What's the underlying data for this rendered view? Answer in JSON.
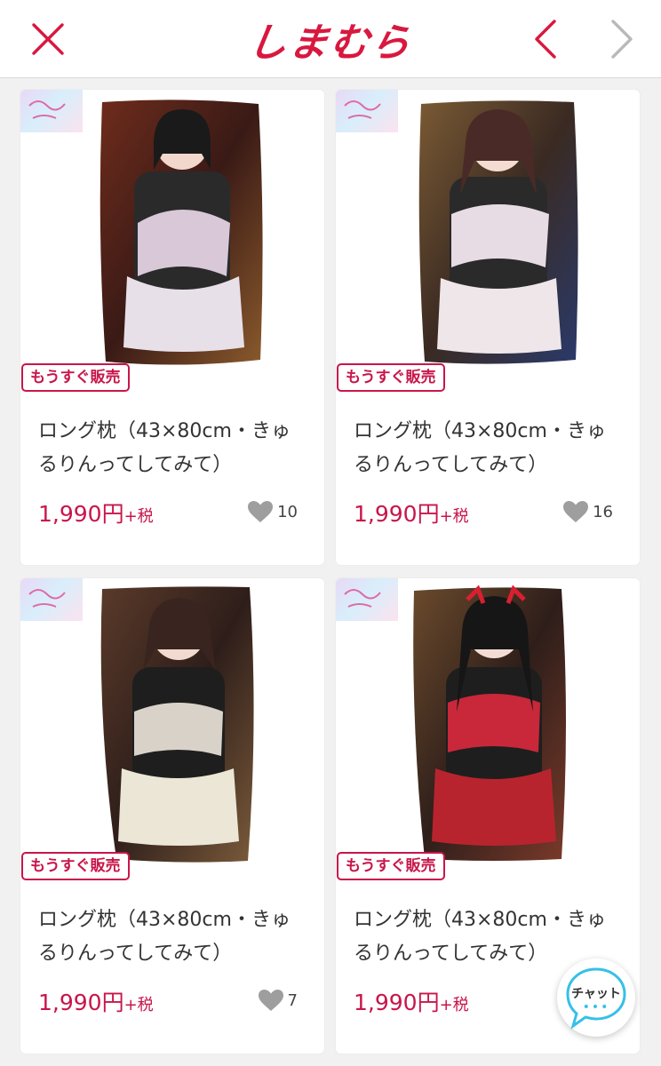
{
  "header": {
    "logo": "しまむら",
    "close_icon": "close-icon",
    "back_icon": "chevron-left-icon",
    "forward_icon": "chevron-right-icon"
  },
  "colors": {
    "brand": "#d8183f",
    "price": "#c8164a",
    "chat_dots": "#36c0e8"
  },
  "products": [
    {
      "status_badge": "もうすぐ販売",
      "title": "ロング枕（43×80cm・きゅるりんってしてみて）",
      "price": "1,990円",
      "tax": "+税",
      "likes": "10"
    },
    {
      "status_badge": "もうすぐ販売",
      "title": "ロング枕（43×80cm・きゅるりんってしてみて）",
      "price": "1,990円",
      "tax": "+税",
      "likes": "16"
    },
    {
      "status_badge": "もうすぐ販売",
      "title": "ロング枕（43×80cm・きゅるりんってしてみて）",
      "price": "1,990円",
      "tax": "+税",
      "likes": "7"
    },
    {
      "status_badge": "もうすぐ販売",
      "title": "ロング枕（43×80cm・きゅるりんってしてみて）",
      "price": "1,990円",
      "tax": "+税",
      "likes": ""
    }
  ],
  "chat": {
    "label": "チャット",
    "dots": "•••"
  }
}
